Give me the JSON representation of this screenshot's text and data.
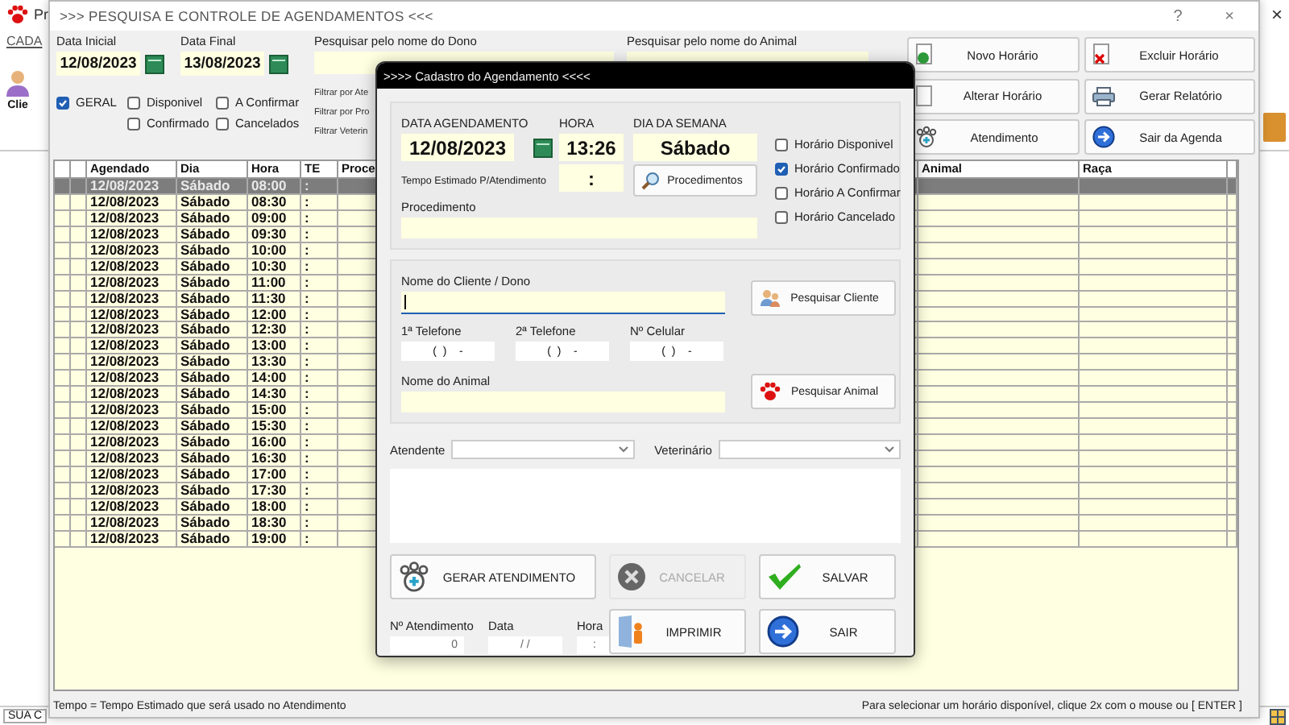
{
  "app": {
    "title": "Pr",
    "close": "×",
    "menu": "CADA",
    "toolbar_item": "Clie",
    "status": "SUA C"
  },
  "main_window": {
    "title": ">>> PESQUISA E CONTROLE DE AGENDAMENTOS <<<",
    "help": "?",
    "close": "×"
  },
  "dates": [
    {
      "label": "Data Inicial",
      "value": "12/08/2023"
    },
    {
      "label": "Data Final",
      "value": "13/08/2023"
    }
  ],
  "filters": [
    {
      "label": "GERAL",
      "checked": true
    },
    {
      "label": "Disponivel",
      "checked": false
    },
    {
      "label": "A Confirmar",
      "checked": false
    },
    {
      "label": "Confirmado",
      "checked": false
    },
    {
      "label": "Cancelados",
      "checked": false
    }
  ],
  "search_owner": {
    "label": "Pesquisar pelo nome do Dono"
  },
  "filter_labels": [
    "Filtrar por Ate",
    "Filtrar por Pro",
    "Filtrar Veterin"
  ],
  "search_animal": {
    "label": "Pesquisar pelo nome do Animal"
  },
  "actions": [
    {
      "label": "Novo Horário",
      "kind": "new"
    },
    {
      "label": "Excluir Horário",
      "kind": "delete"
    },
    {
      "label": "Alterar Horário",
      "kind": "edit"
    },
    {
      "label": "Gerar Relatório",
      "kind": "print"
    },
    {
      "label": "Atendimento",
      "kind": "paw"
    },
    {
      "label": "Sair da Agenda",
      "kind": "exit"
    }
  ],
  "table": {
    "columns": [
      "Agendado",
      "Dia",
      "Hora",
      "TE",
      "Proce",
      "Animal",
      "Raça"
    ],
    "rows": [
      {
        "date": "12/08/2023",
        "day": "Sábado",
        "time": "08:00",
        "te": ":",
        "selected": true
      },
      {
        "date": "12/08/2023",
        "day": "Sábado",
        "time": "08:30",
        "te": ":",
        "selected": false
      },
      {
        "date": "12/08/2023",
        "day": "Sábado",
        "time": "09:00",
        "te": ":",
        "selected": false
      },
      {
        "date": "12/08/2023",
        "day": "Sábado",
        "time": "09:30",
        "te": ":",
        "selected": false
      },
      {
        "date": "12/08/2023",
        "day": "Sábado",
        "time": "10:00",
        "te": ":",
        "selected": false
      },
      {
        "date": "12/08/2023",
        "day": "Sábado",
        "time": "10:30",
        "te": ":",
        "selected": false
      },
      {
        "date": "12/08/2023",
        "day": "Sábado",
        "time": "11:00",
        "te": ":",
        "selected": false
      },
      {
        "date": "12/08/2023",
        "day": "Sábado",
        "time": "11:30",
        "te": ":",
        "selected": false
      },
      {
        "date": "12/08/2023",
        "day": "Sábado",
        "time": "12:00",
        "te": ":",
        "selected": false
      },
      {
        "date": "12/08/2023",
        "day": "Sábado",
        "time": "12:30",
        "te": ":",
        "selected": false
      },
      {
        "date": "12/08/2023",
        "day": "Sábado",
        "time": "13:00",
        "te": ":",
        "selected": false
      },
      {
        "date": "12/08/2023",
        "day": "Sábado",
        "time": "13:30",
        "te": ":",
        "selected": false
      },
      {
        "date": "12/08/2023",
        "day": "Sábado",
        "time": "14:00",
        "te": ":",
        "selected": false
      },
      {
        "date": "12/08/2023",
        "day": "Sábado",
        "time": "14:30",
        "te": ":",
        "selected": false
      },
      {
        "date": "12/08/2023",
        "day": "Sábado",
        "time": "15:00",
        "te": ":",
        "selected": false
      },
      {
        "date": "12/08/2023",
        "day": "Sábado",
        "time": "15:30",
        "te": ":",
        "selected": false
      },
      {
        "date": "12/08/2023",
        "day": "Sábado",
        "time": "16:00",
        "te": ":",
        "selected": false
      },
      {
        "date": "12/08/2023",
        "day": "Sábado",
        "time": "16:30",
        "te": ":",
        "selected": false
      },
      {
        "date": "12/08/2023",
        "day": "Sábado",
        "time": "17:00",
        "te": ":",
        "selected": false
      },
      {
        "date": "12/08/2023",
        "day": "Sábado",
        "time": "17:30",
        "te": ":",
        "selected": false
      },
      {
        "date": "12/08/2023",
        "day": "Sábado",
        "time": "18:00",
        "te": ":",
        "selected": false
      },
      {
        "date": "12/08/2023",
        "day": "Sábado",
        "time": "18:30",
        "te": ":",
        "selected": false
      },
      {
        "date": "12/08/2023",
        "day": "Sábado",
        "time": "19:00",
        "te": ":",
        "selected": false
      }
    ]
  },
  "footer": {
    "left": "Tempo = Tempo Estimado que será usado no Atendimento",
    "right": "Para selecionar um horário disponível, clique 2x com o mouse ou [ ENTER ]"
  },
  "dialog": {
    "title": ">>>> Cadastro do Agendamento <<<<",
    "date": {
      "label": "DATA AGENDAMENTO",
      "value": "12/08/2023"
    },
    "time": {
      "label": "HORA",
      "value": "13:26"
    },
    "weekday": {
      "label": "DIA DA SEMANA",
      "value": "Sábado"
    },
    "estimate": {
      "label": "Tempo Estimado P/Atendimento",
      "value": ":"
    },
    "procedures_button": "Procedimentos",
    "procedure": {
      "label": "Procedimento"
    },
    "statuses": [
      {
        "label": "Horário Disponivel",
        "checked": false
      },
      {
        "label": "Horário Confirmado",
        "checked": true
      },
      {
        "label": "Horário A Confirmar",
        "checked": false
      },
      {
        "label": "Horário Cancelado",
        "checked": false
      }
    ],
    "client": {
      "label": "Nome do Cliente / Dono",
      "button": "Pesquisar Cliente"
    },
    "phones": [
      {
        "label": "1ª Telefone",
        "value": "(  )    -"
      },
      {
        "label": "2ª Telefone",
        "value": "(  )    -"
      },
      {
        "label": "Nº Celular",
        "value": "(  )    -"
      }
    ],
    "animal": {
      "label": "Nome do Animal",
      "button": "Pesquisar Animal"
    },
    "attendant": {
      "label": "Atendente"
    },
    "vet": {
      "label": "Veterinário"
    },
    "buttons": [
      {
        "label": "GERAR ATENDIMENTO",
        "kind": "generate",
        "disabled": false
      },
      {
        "label": "CANCELAR",
        "kind": "cancel",
        "disabled": true
      },
      {
        "label": "SALVAR",
        "kind": "save",
        "disabled": false
      },
      {
        "label": "IMPRIMIR",
        "kind": "print",
        "disabled": false
      },
      {
        "label": "SAIR",
        "kind": "exit",
        "disabled": false
      }
    ],
    "service": [
      {
        "label": "Nº Atendimento",
        "value": "0"
      },
      {
        "label": "Data",
        "value": "/ /"
      },
      {
        "label": "Hora",
        "value": ":"
      }
    ]
  }
}
